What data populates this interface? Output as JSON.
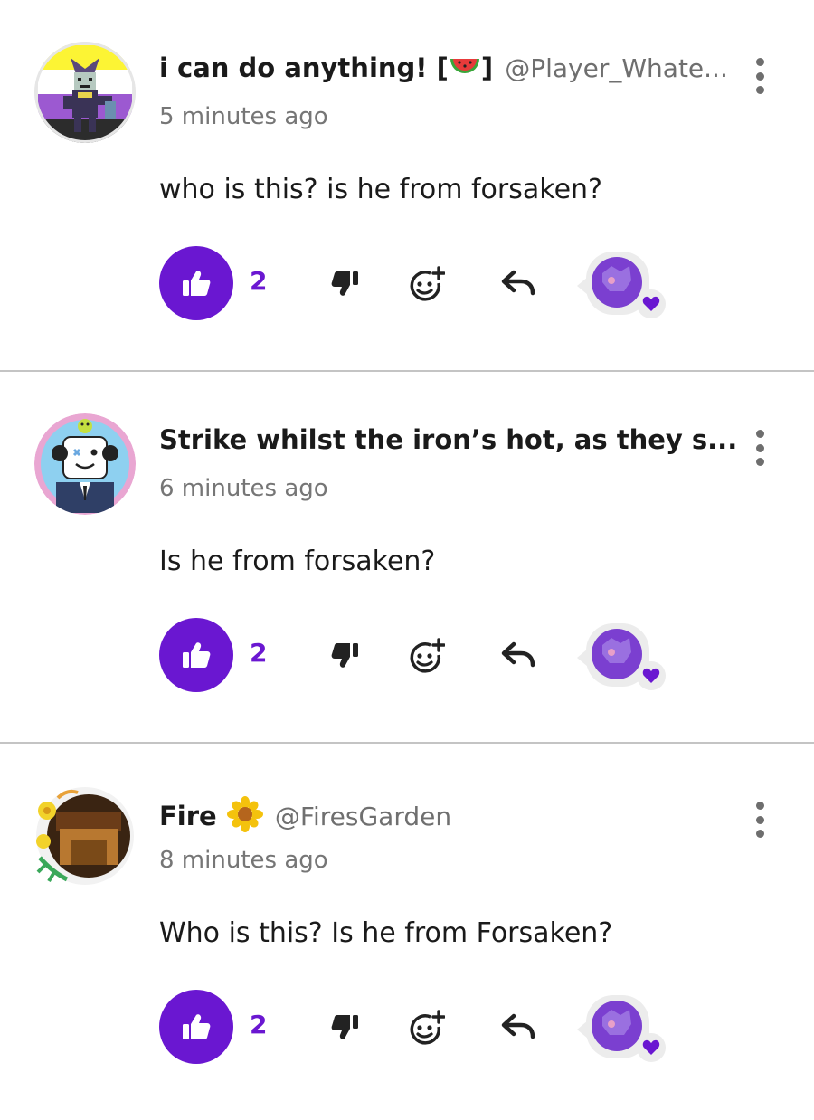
{
  "comments": [
    {
      "name": "i can do anything! [",
      "name_suffix": "]",
      "emoji": "watermelon",
      "handle": "@Player_Whate...",
      "timestamp": "5 minutes ago",
      "text": "who is this? is he from forsaken?",
      "likes": "2",
      "avatar": "jester-icon"
    },
    {
      "name": "Strike whilst the iron’s hot, as they s...",
      "name_suffix": "",
      "emoji": "",
      "handle": "",
      "timestamp": "6 minutes ago",
      "text": "Is he from forsaken?",
      "likes": "2",
      "avatar": "robot-icon"
    },
    {
      "name": "Fire",
      "name_suffix": "",
      "emoji": "sunflower",
      "handle": "@FiresGarden",
      "timestamp": "8 minutes ago",
      "text": "Who is this? Is he from Forsaken?",
      "likes": "2",
      "avatar": "flower-avatar-icon"
    }
  ],
  "colors": {
    "accent": "#6a17d1",
    "heart": "#6a17d1",
    "muted_text": "#767676",
    "divider": "#c4c4c4"
  }
}
